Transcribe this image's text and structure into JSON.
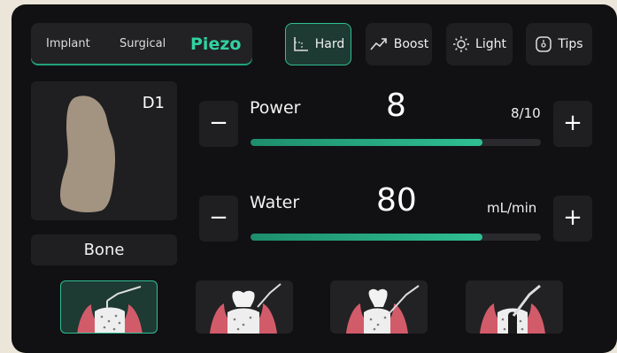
{
  "modes": [
    "Implant",
    "Surgical",
    "Piezo"
  ],
  "selected_mode": "Piezo",
  "toolbar": {
    "hard": "Hard",
    "boost": "Boost",
    "light": "Light",
    "tips": "Tips"
  },
  "density": {
    "label": "D1",
    "material": "Bone"
  },
  "power": {
    "label": "Power",
    "value": "8",
    "unit": "8/10",
    "level": 0.8
  },
  "water": {
    "label": "Water",
    "value": "80",
    "unit": "mL/min",
    "level": 0.8
  },
  "buttons": {
    "minus": "−",
    "plus": "+"
  },
  "procedures": {
    "count": 4,
    "selected_index": 0,
    "items": [
      "bone-osteotomy",
      "tooth-extraction",
      "root-separation",
      "sinus-lift"
    ]
  },
  "colors": {
    "accent": "#2fbf92",
    "bone": "#a39381",
    "gum": "#d25b6a"
  }
}
